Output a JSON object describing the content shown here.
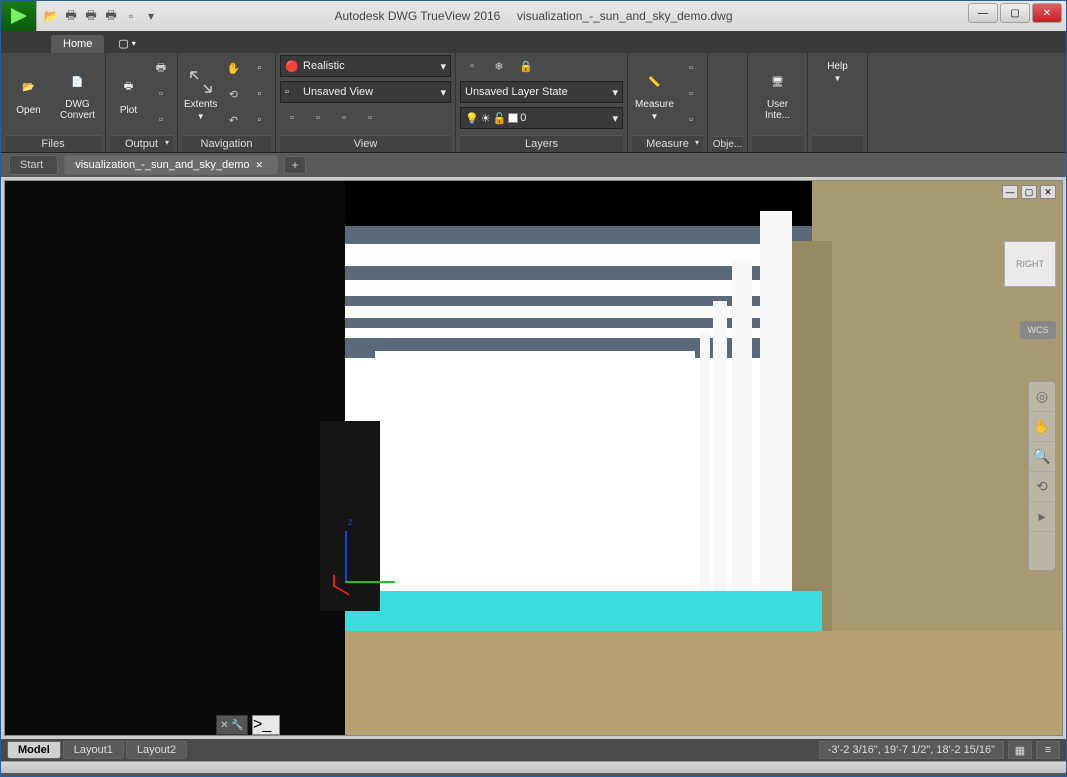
{
  "title": {
    "app": "Autodesk DWG TrueView 2016",
    "doc": "visualization_-_sun_and_sky_demo.dwg"
  },
  "tabs": {
    "home": "Home"
  },
  "ribbon": {
    "files": {
      "open": "Open",
      "convert": "DWG\nConvert",
      "label": "Files"
    },
    "output": {
      "plot": "Plot",
      "label": "Output"
    },
    "nav": {
      "extents": "Extents",
      "label": "Navigation"
    },
    "view": {
      "visual_style": "Realistic",
      "saved_view": "Unsaved View",
      "label": "View"
    },
    "layers": {
      "state": "Unsaved Layer State",
      "current": "0",
      "label": "Layers"
    },
    "measure": {
      "btn": "Measure",
      "label": "Measure"
    },
    "obj": {
      "label": "Obje..."
    },
    "ui": {
      "btn": "User Inte...",
      "help": "Help"
    }
  },
  "filetabs": {
    "start": "Start",
    "doc": "visualization_-_sun_and_sky_demo"
  },
  "viewcube": {
    "face": "RIGHT",
    "wcs": "WCS"
  },
  "layouts": {
    "model": "Model",
    "l1": "Layout1",
    "l2": "Layout2"
  },
  "status": {
    "coords": "-3'-2 3/16\", 19'-7 1/2\", 18'-2 15/16\""
  }
}
